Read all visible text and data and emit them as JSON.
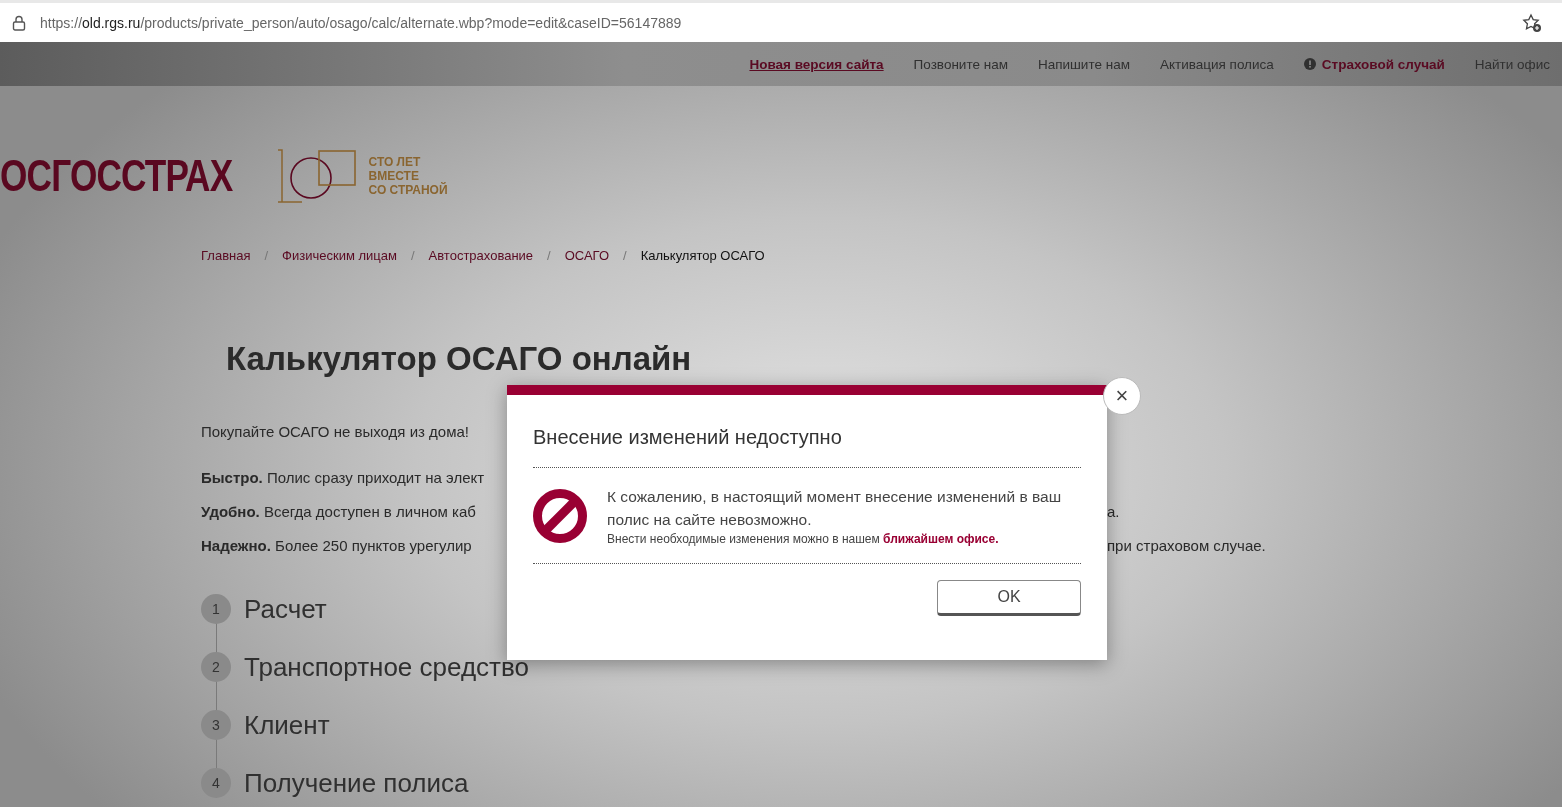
{
  "browser": {
    "url_scheme": "https://",
    "url_host": "old.rgs.ru",
    "url_path": "/products/private_person/auto/osago/calc/alternate.wbp?mode=edit&caseID=56147889"
  },
  "top_nav": [
    {
      "label": "Новая версия сайта",
      "kind": "link"
    },
    {
      "label": "Позвоните нам",
      "kind": "plain"
    },
    {
      "label": "Напишите нам",
      "kind": "plain"
    },
    {
      "label": "Активация полиса",
      "kind": "plain"
    },
    {
      "label": "Страховой случай",
      "kind": "alert"
    },
    {
      "label": "Найти офис",
      "kind": "plain"
    }
  ],
  "logo": {
    "name": "ОСГОССТРАХ",
    "tagline": [
      "СТО ЛЕТ",
      "ВМЕСТЕ",
      "СО СТРАНОЙ"
    ]
  },
  "breadcrumbs": [
    {
      "label": "Главная",
      "current": false
    },
    {
      "separator": "/",
      "label": "Физическим лицам",
      "current": false
    },
    {
      "separator": "/",
      "label": "Автострахование",
      "current": false
    },
    {
      "separator": "/",
      "label": "ОСАГО",
      "current": false
    },
    {
      "separator": "/",
      "label": "Калькулятор ОСАГО",
      "current": true
    }
  ],
  "page_title": "Калькулятор ОСАГО онлайн",
  "intro": "Покупайте ОСАГО не выходя из дома!",
  "features": [
    {
      "text": "**Быстро.** Полис сразу приходит на элект"
    },
    {
      "text": "**Удобно.** Всегда доступен в личном каб",
      "text_right": "а."
    },
    {
      "text": "**Надежно.** Более 250 пунктов урегулир",
      "text_right": "при страховом случае."
    }
  ],
  "steps": [
    {
      "number": "1",
      "label": "Расчет"
    },
    {
      "number": "2",
      "label": "Транспортное средство"
    },
    {
      "number": "3",
      "label": "Клиент"
    },
    {
      "number": "4",
      "label": "Получение полиса"
    }
  ],
  "modal": {
    "title": "Внесение изменений недоступно",
    "message": "К сожалению, в настоящий момент внесение изменений в ваш полис на сайте невозможно.",
    "note": "Внести необходимые изменения можно в нашем",
    "note_link": "ближайшем офисе.",
    "button": "OK",
    "close": "×"
  }
}
